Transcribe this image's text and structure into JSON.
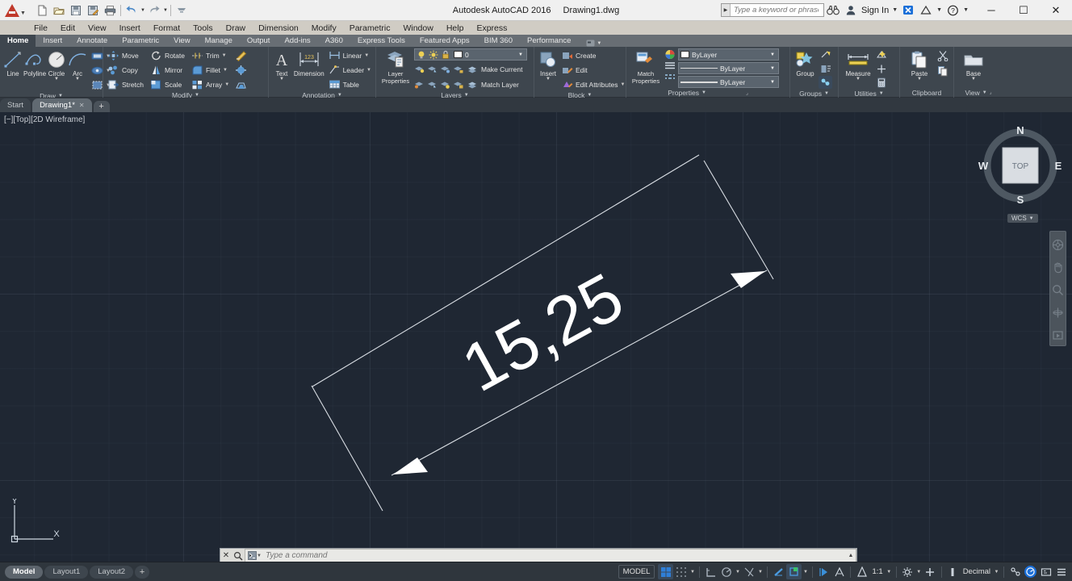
{
  "window": {
    "app_title": "Autodesk AutoCAD 2016",
    "document_title": "Drawing1.dwg",
    "minimize": "─",
    "maximize": "☐",
    "close": "✕"
  },
  "quick_access": {
    "items": [
      {
        "name": "new-file",
        "icon": "new-document-icon"
      },
      {
        "name": "open-file",
        "icon": "open-folder-icon"
      },
      {
        "name": "save-file",
        "icon": "floppy-disk-icon"
      },
      {
        "name": "save-as",
        "icon": "save-as-icon"
      },
      {
        "name": "plot",
        "icon": "printer-icon"
      },
      {
        "name": "undo",
        "icon": "undo-arrow-icon"
      },
      {
        "name": "redo",
        "icon": "redo-arrow-icon"
      },
      {
        "name": "customize",
        "icon": "chevron-down-icon"
      }
    ]
  },
  "search": {
    "placeholder": "Type a keyword or phrase",
    "binoculars_icon": "binoculars-icon"
  },
  "account": {
    "sign_in_label": "Sign In",
    "person_icon": "person-icon",
    "exchange_icon": "autodesk-exchange-icon",
    "help_icon": "help-question-icon"
  },
  "menubar": {
    "items": [
      "File",
      "Edit",
      "View",
      "Insert",
      "Format",
      "Tools",
      "Draw",
      "Dimension",
      "Modify",
      "Parametric",
      "Window",
      "Help",
      "Express"
    ]
  },
  "ribbon_tabs": {
    "items": [
      "Home",
      "Insert",
      "Annotate",
      "Parametric",
      "View",
      "Manage",
      "Output",
      "Add-ins",
      "A360",
      "Express Tools",
      "Featured Apps",
      "BIM 360",
      "Performance"
    ],
    "active": "Home"
  },
  "ribbon": {
    "panels": [
      {
        "title": "Draw",
        "big_buttons": [
          {
            "label": "Line",
            "icon": "line-icon"
          },
          {
            "label": "Polyline",
            "icon": "polyline-icon"
          },
          {
            "label": "Circle",
            "icon": "circle-icon",
            "dropdown": true
          },
          {
            "label": "Arc",
            "icon": "arc-icon",
            "dropdown": true
          }
        ],
        "stack_buttons": [
          {
            "name": "hatch",
            "icon": "hatch-icon"
          },
          {
            "name": "gradient",
            "icon": "gradient-icon"
          },
          {
            "name": "region",
            "icon": "region-icon"
          }
        ]
      },
      {
        "title": "Modify",
        "items": [
          {
            "label": "Move",
            "icon": "move-icon"
          },
          {
            "label": "Copy",
            "icon": "copy-icon"
          },
          {
            "label": "Stretch",
            "icon": "stretch-icon"
          },
          {
            "label": "Rotate",
            "icon": "rotate-icon"
          },
          {
            "label": "Mirror",
            "icon": "mirror-icon"
          },
          {
            "label": "Scale",
            "icon": "scale-icon"
          },
          {
            "label": "Trim",
            "icon": "trim-icon",
            "dropdown": true
          },
          {
            "label": "Fillet",
            "icon": "fillet-icon",
            "dropdown": true
          },
          {
            "label": "Array",
            "icon": "array-icon",
            "dropdown": true
          }
        ],
        "extras": [
          {
            "name": "erase",
            "icon": "eraser-icon"
          },
          {
            "name": "explode",
            "icon": "explode-icon"
          },
          {
            "name": "offset",
            "icon": "offset-icon"
          }
        ]
      },
      {
        "title": "Annotation",
        "big_buttons": [
          {
            "label": "Text",
            "icon": "text-a-icon",
            "dropdown": true
          },
          {
            "label": "Dimension",
            "icon": "dimension-icon"
          }
        ],
        "items": [
          {
            "label": "Linear",
            "icon": "linear-dim-icon",
            "dropdown": true
          },
          {
            "label": "Leader",
            "icon": "leader-icon",
            "dropdown": true
          },
          {
            "label": "Table",
            "icon": "table-icon"
          }
        ]
      },
      {
        "title": "Layers",
        "big_buttons": [
          {
            "label": "Layer\nProperties",
            "icon": "layer-properties-icon"
          }
        ],
        "current_layer": "0",
        "layer_toggles": [
          {
            "name": "layer-on-off",
            "icon": "lightbulb-icon"
          },
          {
            "name": "layer-freeze",
            "icon": "sun-icon"
          },
          {
            "name": "layer-lock",
            "icon": "padlock-icon"
          }
        ],
        "items": [
          {
            "label": "Make Current",
            "icon": "make-current-icon"
          },
          {
            "label": "Match Layer",
            "icon": "match-layer-icon"
          }
        ]
      },
      {
        "title": "Block",
        "big_buttons": [
          {
            "label": "Insert",
            "icon": "insert-block-icon",
            "dropdown": true
          }
        ],
        "items": [
          {
            "label": "Create",
            "icon": "create-block-icon"
          },
          {
            "label": "Edit",
            "icon": "edit-block-icon"
          },
          {
            "label": "Edit Attributes",
            "icon": "edit-attributes-icon",
            "dropdown": true
          }
        ]
      },
      {
        "title": "Properties",
        "big_buttons": [
          {
            "label": "Match\nProperties",
            "icon": "match-properties-icon"
          }
        ],
        "dropdowns": [
          {
            "name": "object-color",
            "value": "ByLayer",
            "icon": "color-wheel-icon"
          },
          {
            "name": "linewidth",
            "value": "ByLayer",
            "icon": "linewidth-icon"
          },
          {
            "name": "linetype",
            "value": "ByLayer",
            "icon": "linetype-icon"
          }
        ]
      },
      {
        "title": "Groups",
        "items": [
          {
            "label": "Group",
            "icon": "group-icon"
          },
          {
            "label": "",
            "icon": "ungroup-icon"
          },
          {
            "label": "",
            "icon": "group-edit-icon"
          },
          {
            "label": "",
            "icon": "group-selection-icon"
          }
        ]
      },
      {
        "title": "Utilities",
        "big_buttons": [
          {
            "label": "Measure",
            "icon": "measure-icon",
            "dropdown": true
          }
        ],
        "extras": [
          {
            "name": "quick-select",
            "icon": "quick-select-icon"
          },
          {
            "name": "point-style",
            "icon": "point-icon"
          },
          {
            "name": "calculator",
            "icon": "calculator-icon"
          }
        ]
      },
      {
        "title": "Clipboard",
        "big_buttons": [
          {
            "label": "Paste",
            "icon": "paste-icon",
            "dropdown": true
          }
        ],
        "extras": [
          {
            "name": "cut",
            "icon": "scissors-icon"
          },
          {
            "name": "copy-clip",
            "icon": "copy-clip-icon"
          }
        ]
      },
      {
        "title": "View",
        "big_buttons": [
          {
            "label": "Base",
            "icon": "base-view-icon",
            "dropdown": true
          }
        ]
      }
    ]
  },
  "file_tabs": {
    "items": [
      {
        "label": "Start",
        "active": false,
        "closable": false
      },
      {
        "label": "Drawing1*",
        "active": true,
        "closable": true
      }
    ],
    "add_label": "+",
    "close_glyph": "✕"
  },
  "viewport": {
    "label": "[−][Top][2D Wireframe]",
    "background_color": "#1f2733",
    "ucs": {
      "x_label": "X",
      "y_label": "Y"
    }
  },
  "viewcube": {
    "face": "TOP",
    "north": "N",
    "east": "E",
    "south": "S",
    "west": "W",
    "coord_system": "WCS"
  },
  "navbar": {
    "items": [
      {
        "name": "steering-wheel-icon"
      },
      {
        "name": "pan-hand-icon"
      },
      {
        "name": "zoom-magnifier-icon"
      },
      {
        "name": "orbit-icon"
      },
      {
        "name": "showmotion-icon"
      }
    ]
  },
  "drawing": {
    "dimension_text": "15,25",
    "line_color": "#d8dde3",
    "text_color": "#ffffff",
    "rotation_deg": -33.5
  },
  "command_line": {
    "placeholder": "Type a command",
    "close_glyph": "✕",
    "search_icon": "magnifier-icon",
    "prompt_icon": "command-prompt-icon",
    "expand_glyph": "▲"
  },
  "status_bar": {
    "layout_tabs": [
      {
        "label": "Model",
        "active": true
      },
      {
        "label": "Layout1",
        "active": false
      },
      {
        "label": "Layout2",
        "active": false
      }
    ],
    "add_layout": "+",
    "space_label": "MODEL",
    "scale": "1:1",
    "units": "Decimal",
    "toggles": [
      {
        "name": "display-drawing-grid",
        "icon": "grid-icon",
        "on": true
      },
      {
        "name": "snap-mode",
        "icon": "snap-icon",
        "on": false
      },
      {
        "name": "ortho-mode",
        "icon": "ortho-icon",
        "on": false
      },
      {
        "name": "polar-tracking",
        "icon": "polar-icon",
        "on": false
      },
      {
        "name": "object-snap-tracking",
        "icon": "osnap-tracking-icon",
        "on": false
      },
      {
        "name": "object-snap",
        "icon": "object-snap-icon",
        "on": false
      },
      {
        "name": "lineweight",
        "icon": "lineweight-icon",
        "on": false
      },
      {
        "name": "transparency",
        "icon": "transparency-icon",
        "on": true
      },
      {
        "name": "selection-cycling",
        "icon": "selection-cycling-icon",
        "on": false
      },
      {
        "name": "annotation-monitor",
        "icon": "annotation-monitor-icon",
        "on": false
      },
      {
        "name": "annotation-visibility",
        "icon": "annotation-visibility-icon",
        "on": false
      },
      {
        "name": "autoscale",
        "icon": "autoscale-icon",
        "on": false
      },
      {
        "name": "workspace-switching",
        "icon": "gear-icon",
        "on": false
      },
      {
        "name": "hardware-acceleration",
        "icon": "plus-icon",
        "on": false
      },
      {
        "name": "isolate-objects",
        "icon": "isolate-icon",
        "on": false
      },
      {
        "name": "clean-screen",
        "icon": "clean-screen-icon",
        "on": false
      },
      {
        "name": "customization",
        "icon": "hamburger-icon",
        "on": false
      }
    ]
  }
}
